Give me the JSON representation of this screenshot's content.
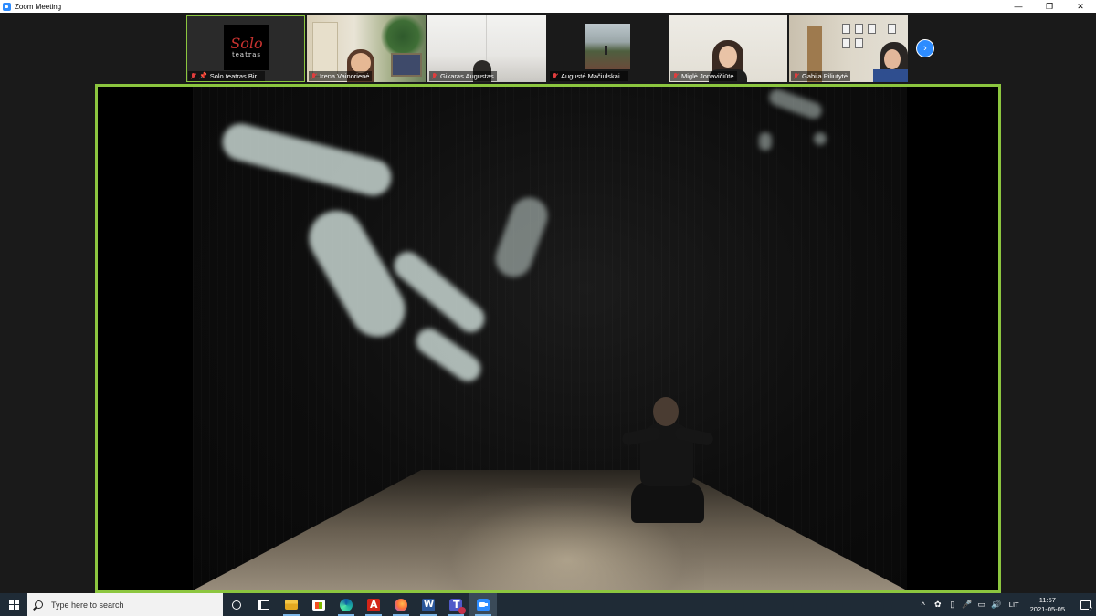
{
  "window": {
    "title": "Zoom Meeting",
    "controls": {
      "minimize": "—",
      "restore": "❐",
      "close": "✕"
    }
  },
  "participants": [
    {
      "name": "Solo teatras  Bir...",
      "muted": true,
      "pinned": true,
      "active": true,
      "logo_line1": "Solo",
      "logo_line2": "teatras"
    },
    {
      "name": "Irena Vainorienė",
      "muted": true
    },
    {
      "name": "Gikaras Augustas",
      "muted": true
    },
    {
      "name": "Augustė Mačiulskai...",
      "muted": true
    },
    {
      "name": "Miglė Jonavičiūtė",
      "muted": true
    },
    {
      "name": "Gabija Piliutytė",
      "muted": true
    }
  ],
  "gallery_next": "›",
  "colors": {
    "active_speaker_border": "#8cc63f",
    "zoom_blue": "#2d8cff",
    "muted_red": "#e03d3d",
    "taskbar": "#1f2b36"
  },
  "taskbar": {
    "search_placeholder": "Type here to search",
    "apps": [
      {
        "name": "cortana-icon"
      },
      {
        "name": "task-view-icon"
      },
      {
        "name": "file-explorer-icon"
      },
      {
        "name": "microsoft-store-icon"
      },
      {
        "name": "edge-icon"
      },
      {
        "name": "acrobat-icon"
      },
      {
        "name": "firefox-icon"
      },
      {
        "name": "word-icon"
      },
      {
        "name": "teams-icon"
      },
      {
        "name": "zoom-icon"
      }
    ],
    "tray": {
      "chevron": "^",
      "language": "LIT",
      "time": "11:57",
      "date": "2021-05-05",
      "notifications_count": "7"
    }
  }
}
